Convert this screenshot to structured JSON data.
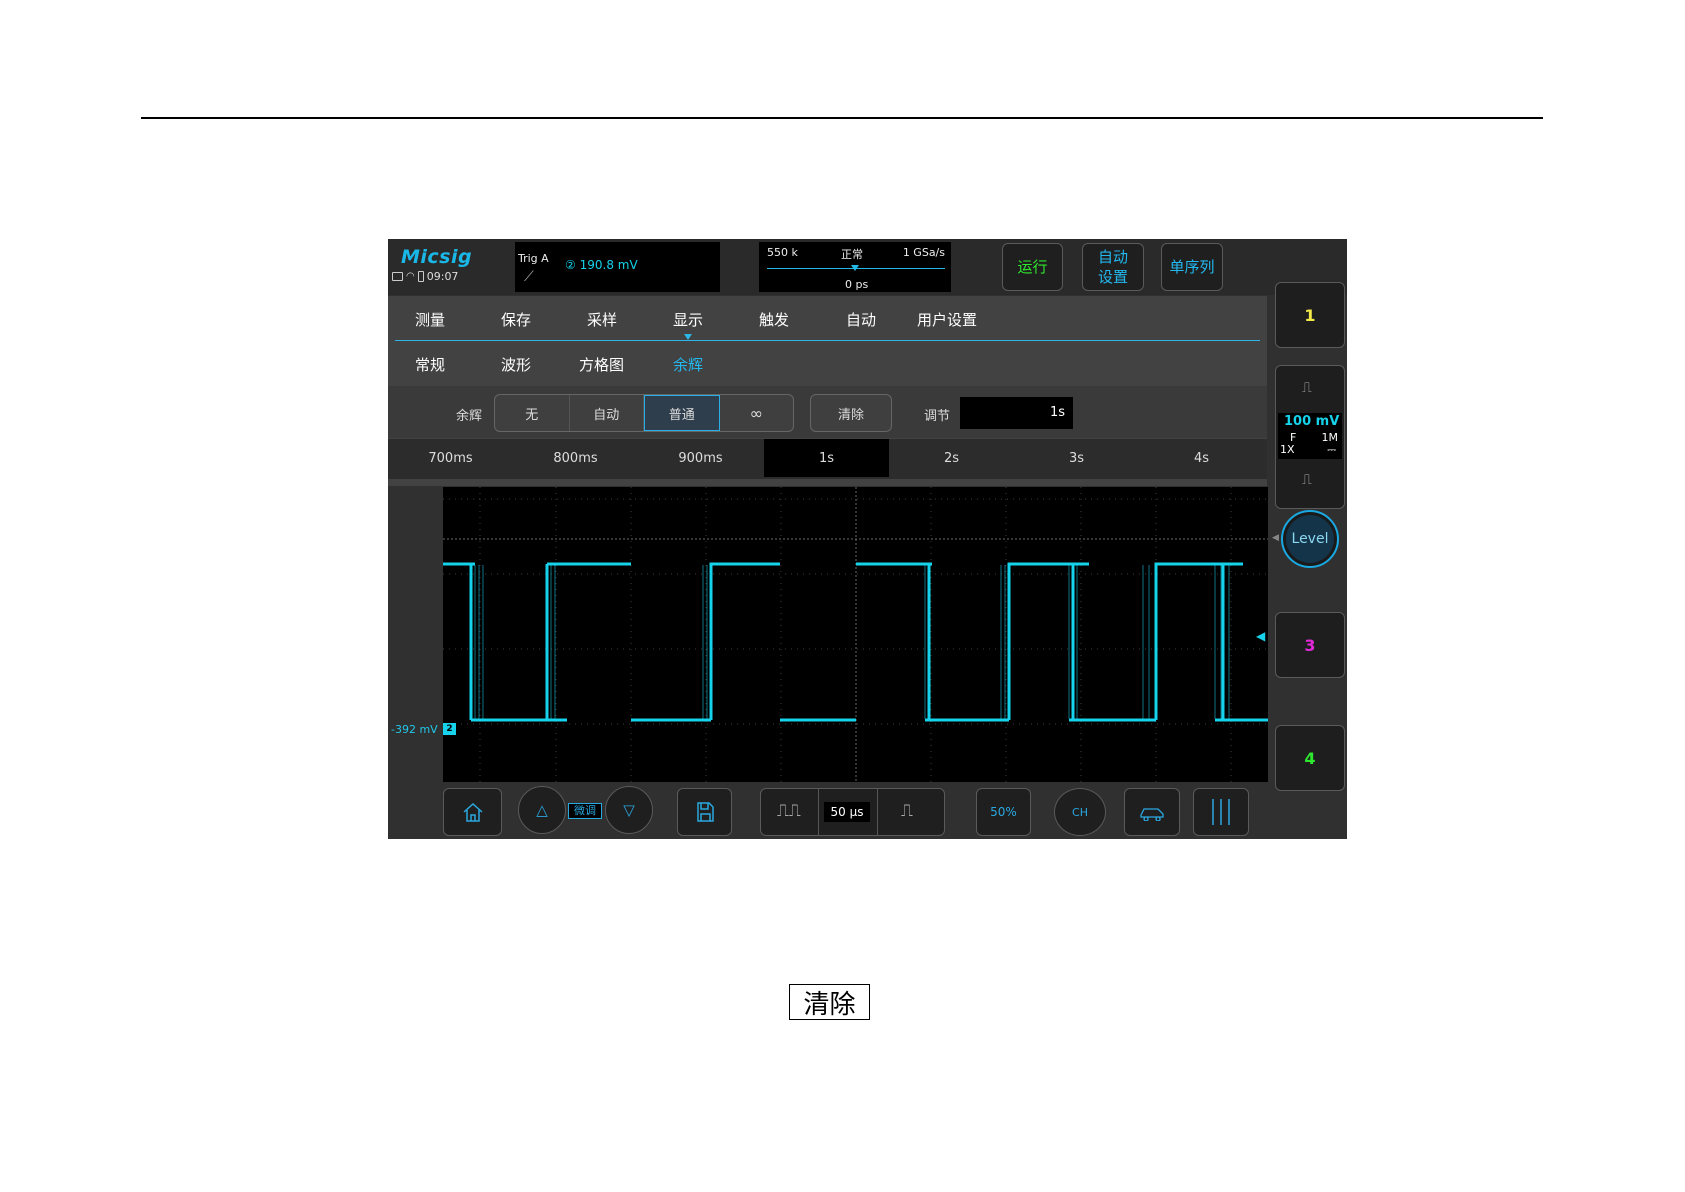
{
  "header": {
    "brand": "Micsig",
    "time": "09:07"
  },
  "trigger": {
    "label": "Trig A",
    "channel_glyph": "②",
    "level": "190.8 mV"
  },
  "timebase": {
    "memory": "550 k",
    "mode": "正常",
    "rate": "1 GSa/s",
    "offset": "0 ps"
  },
  "top_buttons": {
    "run": "运行",
    "auto_line1": "自动",
    "auto_line2": "设置",
    "single": "单序列"
  },
  "menu": {
    "items": [
      "测量",
      "保存",
      "采样",
      "显示",
      "触发",
      "自动",
      "用户设置"
    ],
    "active_index": 3
  },
  "submenu": {
    "items": [
      "常规",
      "波形",
      "方格图",
      "余辉"
    ],
    "active_index": 3
  },
  "persistence": {
    "label": "余辉",
    "options": [
      "无",
      "自动",
      "普通",
      "∞"
    ],
    "selected_index": 2,
    "clear": "清除",
    "adjust_label": "调节",
    "adjust_value": "1s"
  },
  "ranges": {
    "items": [
      "700ms",
      "800ms",
      "900ms",
      "1s",
      "2s",
      "3s",
      "4s"
    ],
    "selected_index": 3
  },
  "channels": {
    "ch1": "1",
    "ch2": {
      "scale": "100 mV",
      "coupling": "F",
      "probe": "1X",
      "impedance": "1M"
    },
    "level_button": "Level",
    "ch3": "3",
    "ch4": "4"
  },
  "waveform": {
    "offset_label": "-392 mV",
    "marker": "2"
  },
  "bottom": {
    "fine_label": "微调",
    "time_scale": "50 μs",
    "fifty_pct": "50%",
    "ch_label": "CH"
  },
  "colors": {
    "accent": "#1ab8e8",
    "trace": "#16d2ea",
    "run": "#2ee82e",
    "ch1": "#f2e84a",
    "ch3": "#e02ad8",
    "ch4": "#2ee82e"
  },
  "footer_button": "清除"
}
